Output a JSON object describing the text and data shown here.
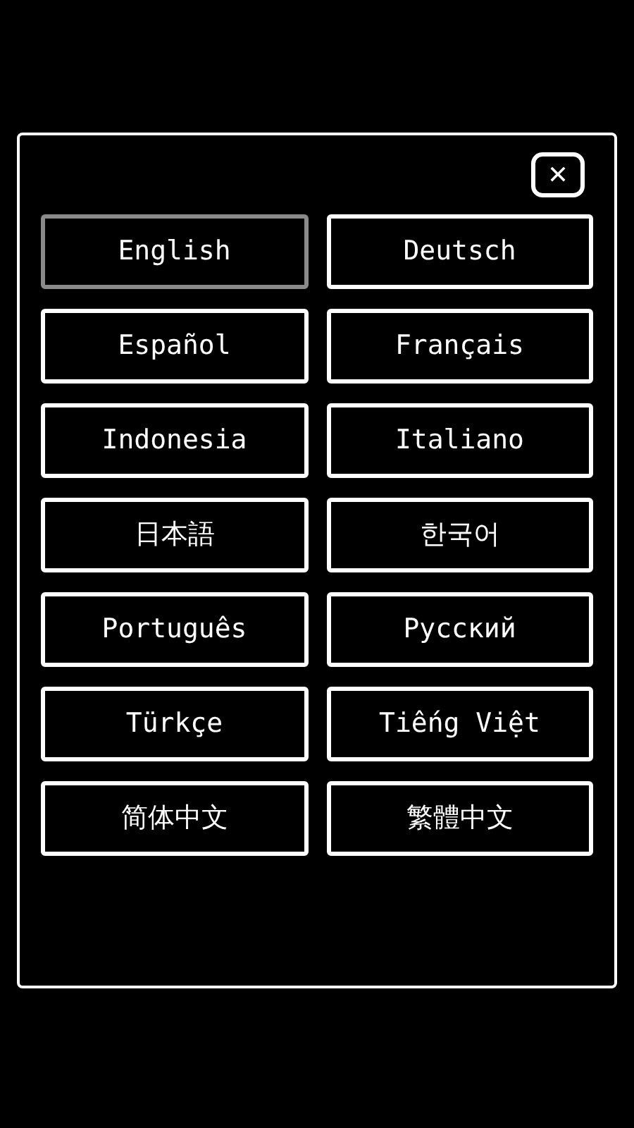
{
  "dialog": {
    "close": "✕"
  },
  "languages": [
    {
      "label": "English",
      "selected": true
    },
    {
      "label": "Deutsch",
      "selected": false
    },
    {
      "label": "Español",
      "selected": false
    },
    {
      "label": "Français",
      "selected": false
    },
    {
      "label": "Indonesia",
      "selected": false
    },
    {
      "label": "Italiano",
      "selected": false
    },
    {
      "label": "日本語",
      "selected": false
    },
    {
      "label": "한국어",
      "selected": false
    },
    {
      "label": "Português",
      "selected": false
    },
    {
      "label": "Русский",
      "selected": false
    },
    {
      "label": "Türkçe",
      "selected": false
    },
    {
      "label": "Tiếng Việt",
      "selected": false
    },
    {
      "label": "简体中文",
      "selected": false
    },
    {
      "label": "繁體中文",
      "selected": false
    }
  ]
}
